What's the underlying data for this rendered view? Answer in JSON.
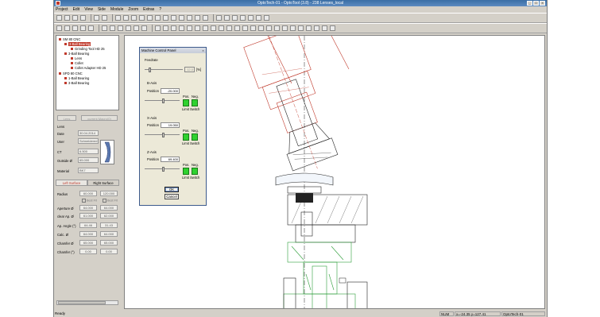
{
  "window": {
    "title": "OptoTech-01 - OptoTool (3.8) - 238 Lenses_local"
  },
  "menu": [
    "Project",
    "Edit",
    "View",
    "Side",
    "Module",
    "Zoom",
    "Extras",
    "?"
  ],
  "tree": {
    "items": [
      "SM 80 CNC",
      "3-Ball Bearing",
      "Grinding Tool HD 25",
      "3-Ball Bearing",
      "Lens",
      "Collet",
      "Collet Adapter HD 25",
      "SPD 80 CNC",
      "1-Ball Bearing",
      "3-Ball Bearing"
    ]
  },
  "lens_panel": {
    "button_label": "Lens",
    "current_macro_label": "current Macro(0)",
    "rows": [
      {
        "label": "Lens",
        "value": ""
      },
      {
        "label": "Date",
        "value": "30.04.2014"
      },
      {
        "label": "User",
        "value": "Schneidered"
      },
      {
        "label": "CT",
        "value": "6.500"
      },
      {
        "label": "Outside Ø",
        "value": "65.000"
      },
      {
        "label": "Material",
        "value": "BK7"
      }
    ]
  },
  "tabs": {
    "left": "Left Surface",
    "right": "Right Surface"
  },
  "surface_table": {
    "rows": [
      {
        "label": "Radius",
        "left": "60.000",
        "right": "120.000"
      },
      {
        "label": "",
        "left": "Best Fit",
        "right": "Best Fit"
      },
      {
        "label": "Aperture Ø",
        "left": "64.000",
        "right": "64.000"
      },
      {
        "label": "clear Ap. Ø",
        "left": "61.000",
        "right": "62.000"
      },
      {
        "label": "Ap. Angle (°)",
        "left": "64.46",
        "right": "31.43"
      },
      {
        "label": "Calc. Ø",
        "left": "64.000",
        "right": "64.000"
      },
      {
        "label": "Chamfer Ø",
        "left": "65.000",
        "right": "65.000"
      },
      {
        "label": "Chamfer (°)",
        "left": "0.00",
        "right": "0.00"
      }
    ]
  },
  "machine_panel": {
    "title": "Machine Control Panel",
    "feedrate_label": "Feedrate",
    "feedrate_value": "12.0",
    "feedrate_unit": "[%]",
    "axes": [
      {
        "name": "B-Axis",
        "position_label": "Position",
        "position": "-20.000",
        "pos_label": "Pos.",
        "neg_label": "Neg.",
        "switch_label": "Limit Switch"
      },
      {
        "name": "X-Axis",
        "position_label": "Position",
        "position": "19.050",
        "pos_label": "Pos.",
        "neg_label": "Neg.",
        "switch_label": "Limit Switch"
      },
      {
        "name": "Z-Axis",
        "position_label": "Position",
        "position": "69.400",
        "pos_label": "Pos.",
        "neg_label": "Neg.",
        "switch_label": "Limit Switch"
      }
    ],
    "ok_label": "OK",
    "cancel_label": "Cancel"
  },
  "status": {
    "left": "Ready",
    "num": "NUM",
    "coords": "x=-24.35  y=127.41",
    "station": "OptoTech-01"
  },
  "colors": {
    "drawing_red": "#c0392b",
    "drawing_green": "#2e9e3a",
    "drawing_black": "#222222",
    "led_green": "#2fd12f"
  }
}
